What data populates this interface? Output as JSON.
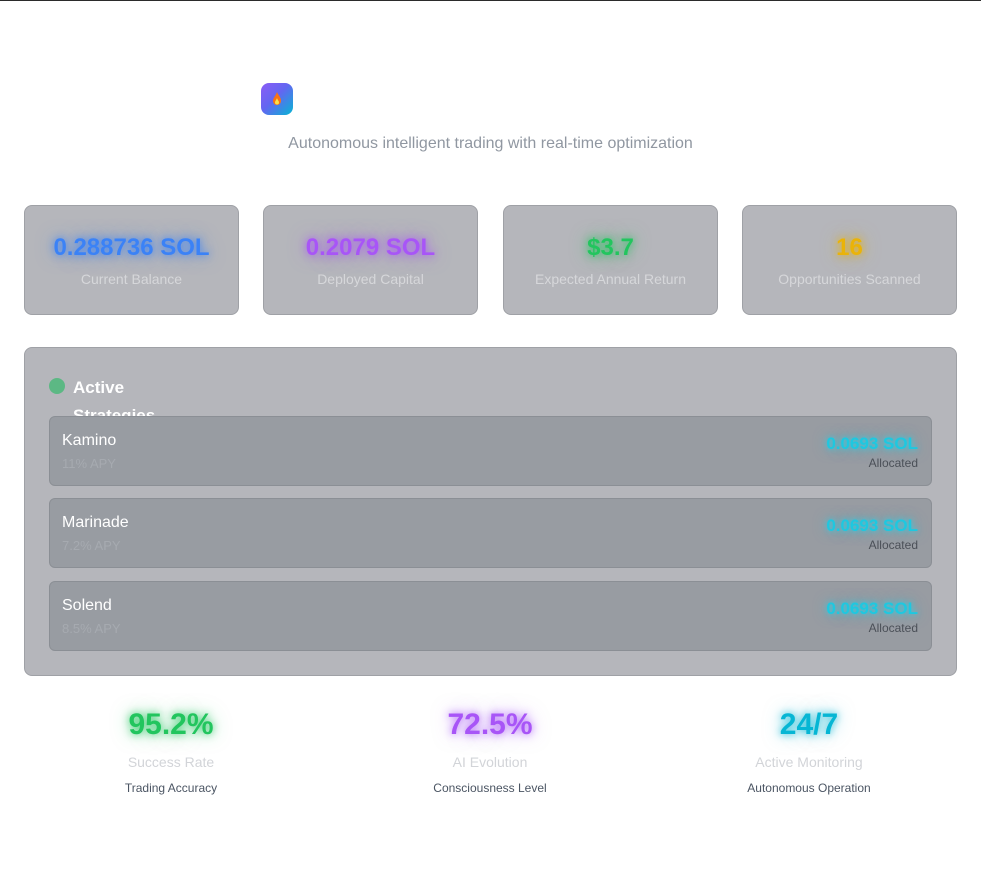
{
  "header": {
    "logo_icon": "flame-icon",
    "subtitle": "Autonomous intelligent trading with real-time optimization"
  },
  "stats": [
    {
      "value": "0.288736 SOL",
      "label": "Current Balance",
      "color": "#3b82f6"
    },
    {
      "value": "0.2079 SOL",
      "label": "Deployed Capital",
      "color": "#a855f7"
    },
    {
      "value": "$3.7",
      "label": "Expected Annual Return",
      "color": "#22c55e"
    },
    {
      "value": "16",
      "label": "Opportunities Scanned",
      "color": "#eab308"
    }
  ],
  "strategies_panel": {
    "status_color": "#5cb884",
    "title": "Active Strategies",
    "items": [
      {
        "name": "Kamino",
        "apy": "11% APY",
        "amount": "0.0693 SOL",
        "allocated_label": "Allocated"
      },
      {
        "name": "Marinade",
        "apy": "7.2% APY",
        "amount": "0.0693 SOL",
        "allocated_label": "Allocated"
      },
      {
        "name": "Solend",
        "apy": "8.5% APY",
        "amount": "0.0693 SOL",
        "allocated_label": "Allocated"
      }
    ]
  },
  "metrics": [
    {
      "value": "95.2%",
      "label": "Success Rate",
      "sub": "Trading Accuracy",
      "color": "#22c55e"
    },
    {
      "value": "72.5%",
      "label": "AI Evolution",
      "sub": "Consciousness Level",
      "color": "#a855f7"
    },
    {
      "value": "24/7",
      "label": "Active Monitoring",
      "sub": "Autonomous Operation",
      "color": "#06b6d4"
    }
  ]
}
